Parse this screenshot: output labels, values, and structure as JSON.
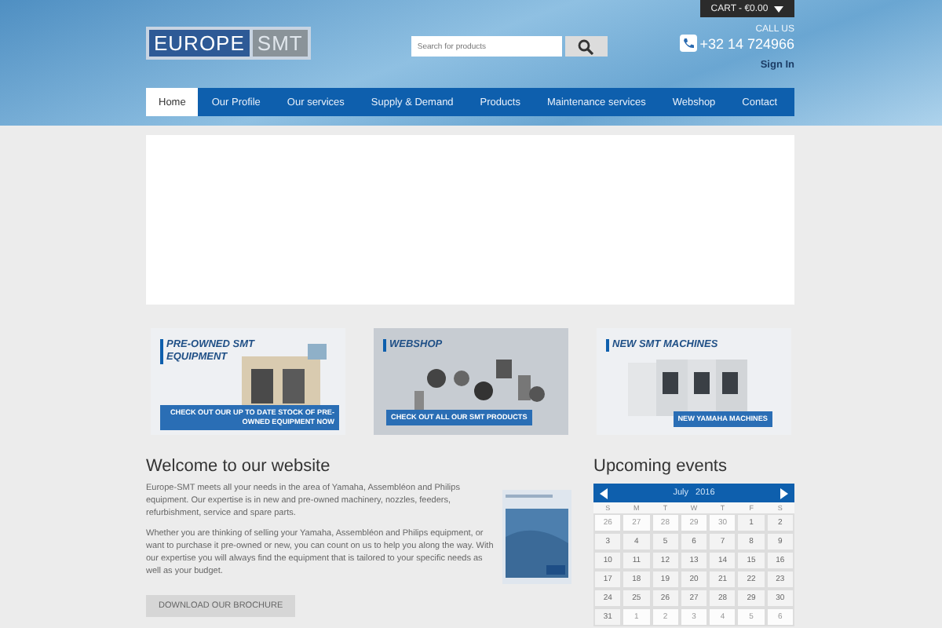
{
  "logo": {
    "part_1": "EUROPE",
    "part_2": "SMT"
  },
  "cart": {
    "label": "CART - €0.00"
  },
  "search": {
    "placeholder": "Search for products"
  },
  "contact": {
    "call_label": "CALL US",
    "phone": "+32 14 724966",
    "sign_in": "Sign In"
  },
  "nav": [
    {
      "label": "Home",
      "selected": true
    },
    {
      "label": "Our Profile",
      "selected": false
    },
    {
      "label": "Our services",
      "selected": false
    },
    {
      "label": "Supply & Demand",
      "selected": false
    },
    {
      "label": "Products",
      "selected": false
    },
    {
      "label": "Maintenance services",
      "selected": false
    },
    {
      "label": "Webshop",
      "selected": false
    },
    {
      "label": "Contact",
      "selected": false
    }
  ],
  "banners": [
    {
      "title": "PRE-OWNED SMT EQUIPMENT",
      "caption": "CHECK OUT OUR UP TO DATE STOCK OF PRE-OWNED EQUIPMENT NOW",
      "kind": "machine"
    },
    {
      "title": "WEBSHOP",
      "caption": "CHECK OUT ALL OUR SMT PRODUCTS",
      "kind": "parts"
    },
    {
      "title": "NEW SMT MACHINES",
      "caption": "NEW YAMAHA MACHINES",
      "kind": "line"
    }
  ],
  "welcome": {
    "heading": "Welcome to our website",
    "paragraphs": [
      "Europe-SMT meets all your needs in the area of Yamaha, Assembléon and Philips equipment. Our expertise is in new and pre-owned machinery, nozzles, feeders, refurbishment, service and spare parts.",
      "Whether you are thinking of selling your Yamaha, Assembléon and Philips equipment, or want to purchase it pre-owned or new, you can count on us to help you along the way. With our expertise you will always find the equipment that is tailored to your specific needs as well as your budget."
    ],
    "button": "DOWNLOAD OUR BROCHURE"
  },
  "events": {
    "heading": "Upcoming events",
    "month": "July",
    "year": "2016",
    "weekdays": [
      "S",
      "M",
      "T",
      "W",
      "T",
      "F",
      "S"
    ],
    "weeks": [
      [
        {
          "day": "26",
          "other": true
        },
        {
          "day": "27",
          "other": true
        },
        {
          "day": "28",
          "other": true
        },
        {
          "day": "29",
          "other": true
        },
        {
          "day": "30",
          "other": true
        },
        {
          "day": "1",
          "other": false
        },
        {
          "day": "2",
          "other": false
        }
      ],
      [
        {
          "day": "3",
          "other": false
        },
        {
          "day": "4",
          "other": false
        },
        {
          "day": "5",
          "other": false
        },
        {
          "day": "6",
          "other": false
        },
        {
          "day": "7",
          "other": false
        },
        {
          "day": "8",
          "other": false
        },
        {
          "day": "9",
          "other": false
        }
      ],
      [
        {
          "day": "10",
          "other": false
        },
        {
          "day": "11",
          "other": false
        },
        {
          "day": "12",
          "other": false
        },
        {
          "day": "13",
          "other": false
        },
        {
          "day": "14",
          "other": false
        },
        {
          "day": "15",
          "other": false
        },
        {
          "day": "16",
          "other": false
        }
      ],
      [
        {
          "day": "17",
          "other": false
        },
        {
          "day": "18",
          "other": false
        },
        {
          "day": "19",
          "other": false
        },
        {
          "day": "20",
          "other": false
        },
        {
          "day": "21",
          "other": false
        },
        {
          "day": "22",
          "other": false
        },
        {
          "day": "23",
          "other": false
        }
      ],
      [
        {
          "day": "24",
          "other": false
        },
        {
          "day": "25",
          "other": false
        },
        {
          "day": "26",
          "other": false
        },
        {
          "day": "27",
          "other": false
        },
        {
          "day": "28",
          "other": false
        },
        {
          "day": "29",
          "other": false
        },
        {
          "day": "30",
          "other": false
        }
      ],
      [
        {
          "day": "31",
          "other": false
        },
        {
          "day": "1",
          "other": true
        },
        {
          "day": "2",
          "other": true
        },
        {
          "day": "3",
          "other": true
        },
        {
          "day": "4",
          "other": true
        },
        {
          "day": "5",
          "other": true
        },
        {
          "day": "6",
          "other": true
        }
      ]
    ]
  }
}
